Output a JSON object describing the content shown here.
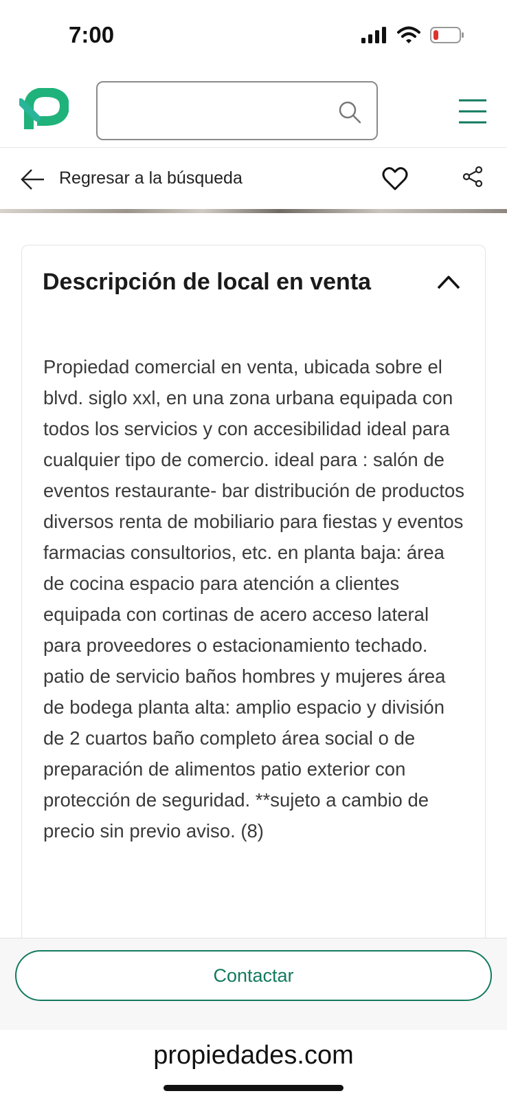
{
  "status_bar": {
    "time": "7:00"
  },
  "header": {
    "brand_icon": "propiedades-logo",
    "search": {
      "placeholder": ""
    },
    "menu_icon": "hamburger-menu-icon"
  },
  "nav": {
    "back_label": "Regresar a la búsqueda"
  },
  "description": {
    "title": "Descripción de local en venta",
    "expanded": true,
    "body": "Propiedad comercial en venta, ubicada sobre el blvd. siglo xxl, en una zona urbana equipada con todos los servicios y con accesibilidad ideal para cualquier tipo de comercio. ideal para : salón de eventos restaurante- bar distribución de productos diversos renta de mobiliario para fiestas y eventos farmacias consultorios, etc. en planta baja: área de cocina espacio para atención a clientes equipada con cortinas de acero acceso lateral para proveedores o estacionamiento techado. patio de servicio baños hombres y mujeres área de bodega planta alta: amplio espacio y división de 2 cuartos baño completo área social o de preparación de alimentos patio exterior con protección de seguridad. **sujeto a cambio de precio sin previo aviso.   (8)"
  },
  "contact": {
    "button_label": "Contactar"
  },
  "browser": {
    "url": "propiedades.com"
  },
  "colors": {
    "brand_green": "#127a5e",
    "logo_green": "#1fb27a",
    "logo_teal": "#2ab59a"
  }
}
